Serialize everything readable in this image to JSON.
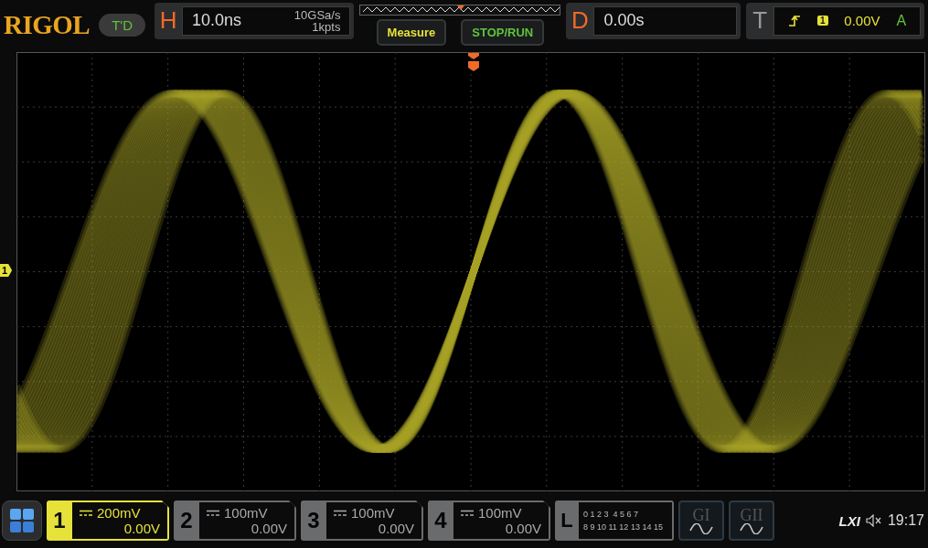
{
  "brand": "RIGOL",
  "mode": "T'D",
  "horizontal": {
    "label": "H",
    "timebase": "10.0ns",
    "sample_rate": "10GSa/s",
    "memory": "1kpts"
  },
  "buttons": [
    "Measure",
    "STOP/RUN"
  ],
  "delay": {
    "label": "D",
    "value": "0.00s"
  },
  "trigger": {
    "label": "T",
    "source": "1",
    "level": "0.00V",
    "mode": "A"
  },
  "channel_marker": "1",
  "channels": [
    {
      "number": "1",
      "scale": "200mV",
      "offset": "0.00V",
      "on": true
    },
    {
      "number": "2",
      "scale": "100mV",
      "offset": "0.00V",
      "on": false
    },
    {
      "number": "3",
      "scale": "100mV",
      "offset": "0.00V",
      "on": false
    },
    {
      "number": "4",
      "scale": "100mV",
      "offset": "0.00V",
      "on": false
    }
  ],
  "logic": {
    "label": "L",
    "row_1": "0 1 2 3  4 5 6 7",
    "row_2": "8 9 10 11 12 13 14 15"
  },
  "generators": [
    "GI",
    "GII"
  ],
  "status": {
    "lxi": "LXI",
    "time": "19:17"
  }
}
